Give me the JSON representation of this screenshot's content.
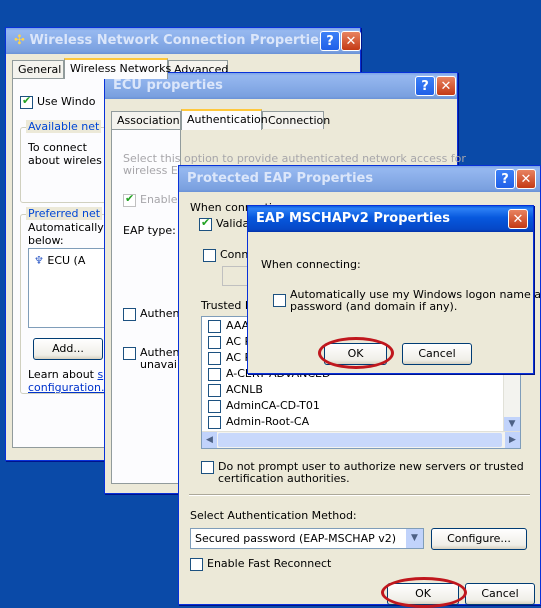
{
  "win1": {
    "title": "Wireless Network Connection Properties",
    "tabs": [
      "General",
      "Wireless Networks",
      "Advanced"
    ],
    "use_windows": "Use Windo",
    "available_label": "Available net",
    "to_connect_1": "To connect",
    "to_connect_2": "about wireles",
    "preferred_label": "Preferred net",
    "automatically": "Automatically",
    "below": "below:",
    "network_item": "ECU (A",
    "add_button": "Add...",
    "learn_about": "Learn about",
    "configuration": "configuration."
  },
  "win2": {
    "title": "ECU properties",
    "tabs": [
      "Association",
      "Authentication",
      "Connection"
    ],
    "select_text_1": "Select this option to provide authenticated network access for",
    "select_text_2": "wireless Eth",
    "enable": "Enable",
    "eap_type": "EAP type:",
    "authen1": "Authent",
    "authen2": "Authent",
    "unavail": "unavail"
  },
  "win3": {
    "title": "Protected EAP Properties",
    "when_connecting": "When connecti",
    "validate": "Validate",
    "connect": "Conne",
    "trusted_label": "Trusted R",
    "cas": [
      "AAA",
      "AC R",
      "AC R",
      "A-CERT ADVANCED",
      "ACNLB",
      "AdminCA-CD-T01",
      "Admin-Root-CA"
    ],
    "do_not_prompt_1": "Do not prompt user to authorize new servers or trusted",
    "do_not_prompt_2": "certification authorities.",
    "select_method_label": "Select Authentication Method:",
    "method_value": "Secured password (EAP-MSCHAP v2)",
    "configure_button": "Configure...",
    "fast_reconnect": "Enable Fast Reconnect",
    "ok_button": "OK",
    "cancel_button": "Cancel"
  },
  "win4": {
    "title": "EAP MSCHAPv2 Properties",
    "when_connecting": "When connecting:",
    "auto_use_1": "Automatically use my Windows logon name and",
    "auto_use_2": "password (and domain if any).",
    "ok_button": "OK",
    "cancel_button": "Cancel"
  },
  "colors": {
    "highlight_oval": "#c0171d",
    "desktop": "#0a4aa8",
    "title_active": "#0758dd"
  }
}
